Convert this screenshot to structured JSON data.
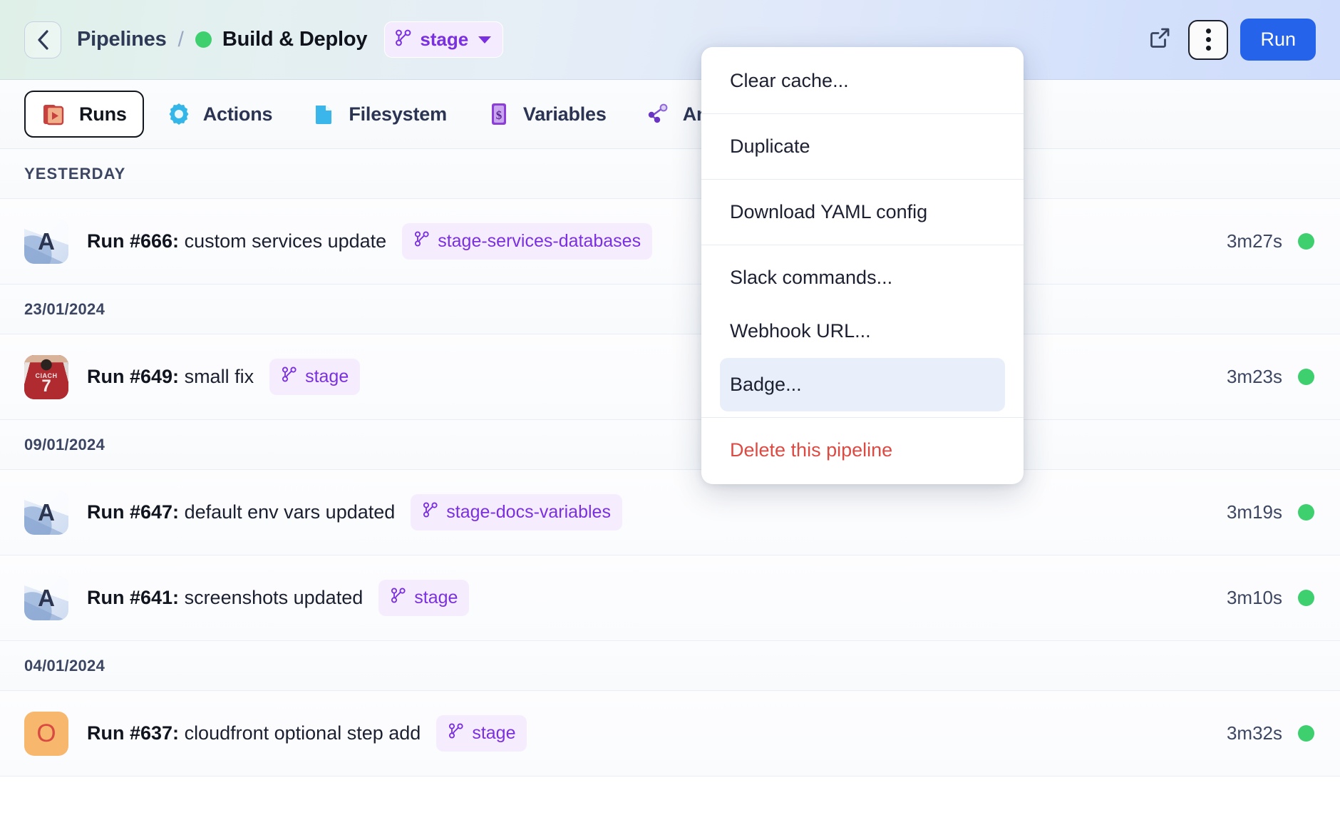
{
  "header": {
    "back_icon": "chevron-left-icon",
    "breadcrumb_root": "Pipelines",
    "breadcrumb_separator": "/",
    "breadcrumb_current": "Build & Deploy",
    "status_color": "#3ecf6f",
    "branch_selector": {
      "label": "stage",
      "icon": "branch-icon",
      "caret": "chevron-down-icon"
    },
    "open_external_icon": "external-link-icon",
    "more_icon": "kebab-menu-icon",
    "run_label": "Run",
    "run_color": "#2563eb"
  },
  "tabs": [
    {
      "label": "Runs",
      "icon": "runs-icon",
      "active": true
    },
    {
      "label": "Actions",
      "icon": "actions-gear-icon",
      "active": false
    },
    {
      "label": "Filesystem",
      "icon": "filesystem-folder-icon",
      "active": false
    },
    {
      "label": "Variables",
      "icon": "variables-dollar-icon",
      "active": false
    },
    {
      "label": "Analytics",
      "icon": "analytics-graph-icon",
      "active": false
    },
    {
      "label": "",
      "icon": "cut-off-tab-icon",
      "active": false
    }
  ],
  "menu": {
    "groups": [
      {
        "items": [
          {
            "label": "Clear cache...",
            "style": "normal"
          }
        ]
      },
      {
        "items": [
          {
            "label": "Duplicate",
            "style": "normal"
          }
        ]
      },
      {
        "items": [
          {
            "label": "Download YAML config",
            "style": "normal"
          }
        ]
      },
      {
        "items": [
          {
            "label": "Slack commands...",
            "style": "normal"
          },
          {
            "label": "Webhook URL...",
            "style": "normal"
          },
          {
            "label": "Badge...",
            "style": "highlight"
          }
        ]
      },
      {
        "items": [
          {
            "label": "Delete this pipeline",
            "style": "danger"
          }
        ]
      }
    ],
    "danger_color": "#dc4b43",
    "highlight_color": "#e9eefb"
  },
  "list": [
    {
      "kind": "date",
      "label": "YESTERDAY",
      "upper": true
    },
    {
      "kind": "run",
      "avatar": {
        "type": "geo",
        "letter": "A"
      },
      "run_number": "Run #666:",
      "message": "custom services update",
      "branch": "stage-services-databases",
      "duration": "3m27s",
      "status": "success"
    },
    {
      "kind": "date",
      "label": "23/01/2024",
      "upper": false
    },
    {
      "kind": "run",
      "avatar": {
        "type": "photo",
        "letter": "",
        "club": "CIACH",
        "number": "7"
      },
      "run_number": "Run #649:",
      "message": "small fix",
      "branch": "stage",
      "duration": "3m23s",
      "status": "success"
    },
    {
      "kind": "date",
      "label": "09/01/2024",
      "upper": false
    },
    {
      "kind": "run",
      "avatar": {
        "type": "geo",
        "letter": "A"
      },
      "run_number": "Run #647:",
      "message": "default env vars updated",
      "branch": "stage-docs-variables",
      "duration": "3m19s",
      "status": "success"
    },
    {
      "kind": "run",
      "avatar": {
        "type": "geo",
        "letter": "A"
      },
      "run_number": "Run #641:",
      "message": "screenshots updated",
      "branch": "stage",
      "duration": "3m10s",
      "status": "success"
    },
    {
      "kind": "date",
      "label": "04/01/2024",
      "upper": false
    },
    {
      "kind": "run",
      "avatar": {
        "type": "orange",
        "letter": "O"
      },
      "run_number": "Run #637:",
      "message": "cloudfront optional step add",
      "branch": "stage",
      "duration": "3m32s",
      "status": "success"
    }
  ],
  "status_colors": {
    "success": "#3ecf6f"
  }
}
